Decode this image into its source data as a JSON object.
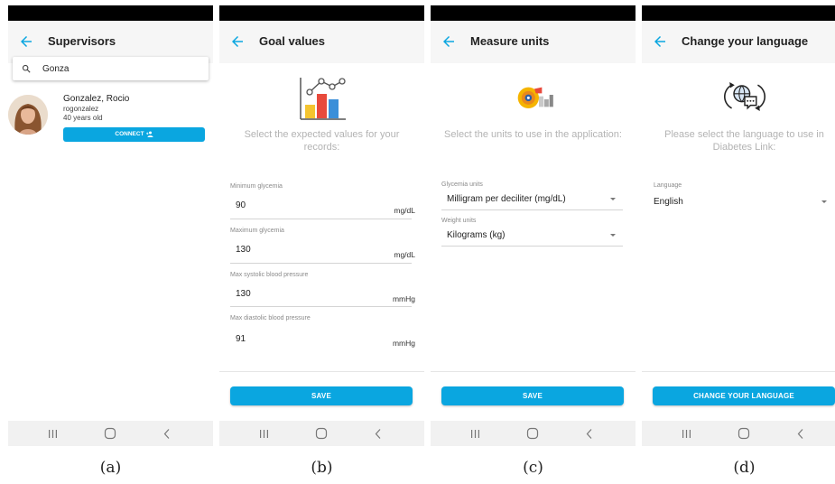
{
  "panels": {
    "a": {
      "title": "Supervisors",
      "search": {
        "value": "Gonza"
      },
      "supervisor": {
        "name": "Gonzalez, Rocio",
        "username": "rogonzalez",
        "age": "40 years old",
        "connect_label": "CONNECT"
      },
      "caption": "(a)"
    },
    "b": {
      "title": "Goal values",
      "prompt": "Select the expected values for your records:",
      "fields": [
        {
          "label": "Minimum glycemia",
          "value": "90",
          "unit": "mg/dL"
        },
        {
          "label": "Maximum glycemia",
          "value": "130",
          "unit": "mg/dL"
        },
        {
          "label": "Max systolic blood pressure",
          "value": "130",
          "unit": "mmHg"
        },
        {
          "label": "Max diastolic blood pressure",
          "value": "91",
          "unit": "mmHg"
        }
      ],
      "save_label": "SAVE",
      "caption": "(b)"
    },
    "c": {
      "title": "Measure units",
      "prompt": "Select the units to use in the application:",
      "fields": [
        {
          "label": "Glycemia units",
          "value": "Milligram per deciliter (mg/dL)"
        },
        {
          "label": "Weight units",
          "value": "Kilograms (kg)"
        }
      ],
      "save_label": "SAVE",
      "caption": "(c)"
    },
    "d": {
      "title": "Change your language",
      "prompt": "Please select the language to use in Diabetes Link:",
      "field": {
        "label": "Language",
        "value": "English"
      },
      "button_label": "CHANGE YOUR LANGUAGE",
      "caption": "(d)"
    }
  },
  "colors": {
    "accent": "#0aa6e0",
    "appbar": "#f6f6f6",
    "prompt_text": "#b3b3b3"
  },
  "icons": [
    "back-arrow-icon",
    "search-icon",
    "person-add-icon",
    "chart-icon",
    "measure-units-icon",
    "language-globe-icon",
    "nav-recents-icon",
    "nav-home-icon",
    "nav-back-icon",
    "dropdown-caret-icon"
  ]
}
